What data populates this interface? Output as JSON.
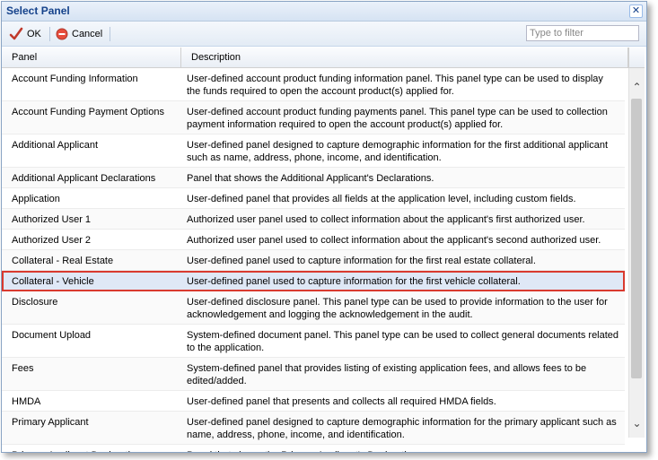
{
  "dialog": {
    "title": "Select Panel"
  },
  "toolbar": {
    "ok_label": "OK",
    "cancel_label": "Cancel",
    "filter_placeholder": "Type to filter"
  },
  "grid": {
    "columns": [
      "Panel",
      "Description"
    ],
    "rows": [
      {
        "panel": "Account Funding Information",
        "description": "User-defined account product funding information panel. This panel type can be used to display the funds required to open the account product(s) applied for."
      },
      {
        "panel": "Account Funding Payment Options",
        "description": "User-defined account product funding payments panel. This panel type can be used to collection payment information required to open the account product(s) applied for."
      },
      {
        "panel": "Additional Applicant",
        "description": "User-defined panel designed to capture demographic information for the first additional applicant such as name, address, phone, income, and identification."
      },
      {
        "panel": "Additional Applicant Declarations",
        "description": "Panel that shows the Additional Applicant's Declarations."
      },
      {
        "panel": "Application",
        "description": "User-defined panel that provides all fields at the application level, including custom fields."
      },
      {
        "panel": "Authorized User 1",
        "description": "Authorized user panel used to collect information about the applicant's first authorized user."
      },
      {
        "panel": "Authorized User 2",
        "description": "Authorized user panel used to collect information about the applicant's second authorized user."
      },
      {
        "panel": "Collateral - Real Estate",
        "description": "User-defined panel used to capture information for the first real estate collateral."
      },
      {
        "panel": "Collateral - Vehicle",
        "description": "User-defined panel used to capture information for the first vehicle collateral.",
        "selected": true
      },
      {
        "panel": "Disclosure",
        "description": "User-defined disclosure panel. This panel type can be used to provide information to the user for acknowledgement and logging the acknowledgement in the audit."
      },
      {
        "panel": "Document Upload",
        "description": "System-defined document panel. This panel type can be used to collect general documents related to the application."
      },
      {
        "panel": "Fees",
        "description": "System-defined panel that provides listing of existing application fees, and allows fees to be edited/added."
      },
      {
        "panel": "HMDA",
        "description": "User-defined panel that presents and collects all required HMDA fields."
      },
      {
        "panel": "Primary Applicant",
        "description": "User-defined panel designed to capture demographic information for the primary applicant such as name, address, phone, income, and identification."
      },
      {
        "panel": "Primary Applicant Declarations",
        "description": "Panel that shows the Primary Applicant's Declarations."
      }
    ]
  },
  "colors": {
    "selected_bg": "#dfe8f6",
    "selected_outline": "#d93a2f",
    "title": "#15428b"
  },
  "icons": {
    "ok": "checkmark-icon",
    "cancel": "cancel-icon",
    "close": "close-icon"
  }
}
